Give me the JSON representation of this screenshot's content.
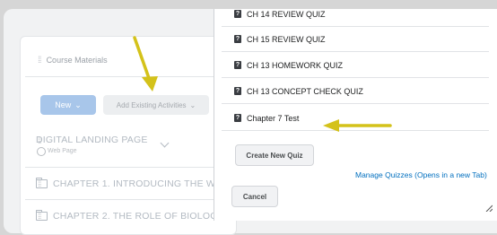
{
  "background": {
    "section_title": "Course Materials",
    "new_button": "New",
    "add_existing_button": "Add Existing Activities",
    "landing_page_title": "DIGITAL LANDING PAGE",
    "landing_page_type": "Web Page",
    "chapters": [
      "CHAPTER 1. INTRODUCING THE WO",
      "CHAPTER 2. THE ROLE OF BIOLOGY"
    ]
  },
  "dialog": {
    "quizzes": [
      {
        "label": "CH 14 REVIEW QUIZ"
      },
      {
        "label": "CH 15 REVIEW QUIZ"
      },
      {
        "label": "CH 13 HOMEWORK QUIZ"
      },
      {
        "label": "CH 13 CONCEPT CHECK QUIZ"
      },
      {
        "label": "Chapter 7 Test"
      }
    ],
    "quiz_icon_glyph": "?",
    "create_button": "Create New Quiz",
    "manage_link": "Manage Quizzes (Opens in a new Tab)",
    "cancel_button": "Cancel"
  },
  "annotations": {
    "arrow_color": "#d4c21a"
  }
}
